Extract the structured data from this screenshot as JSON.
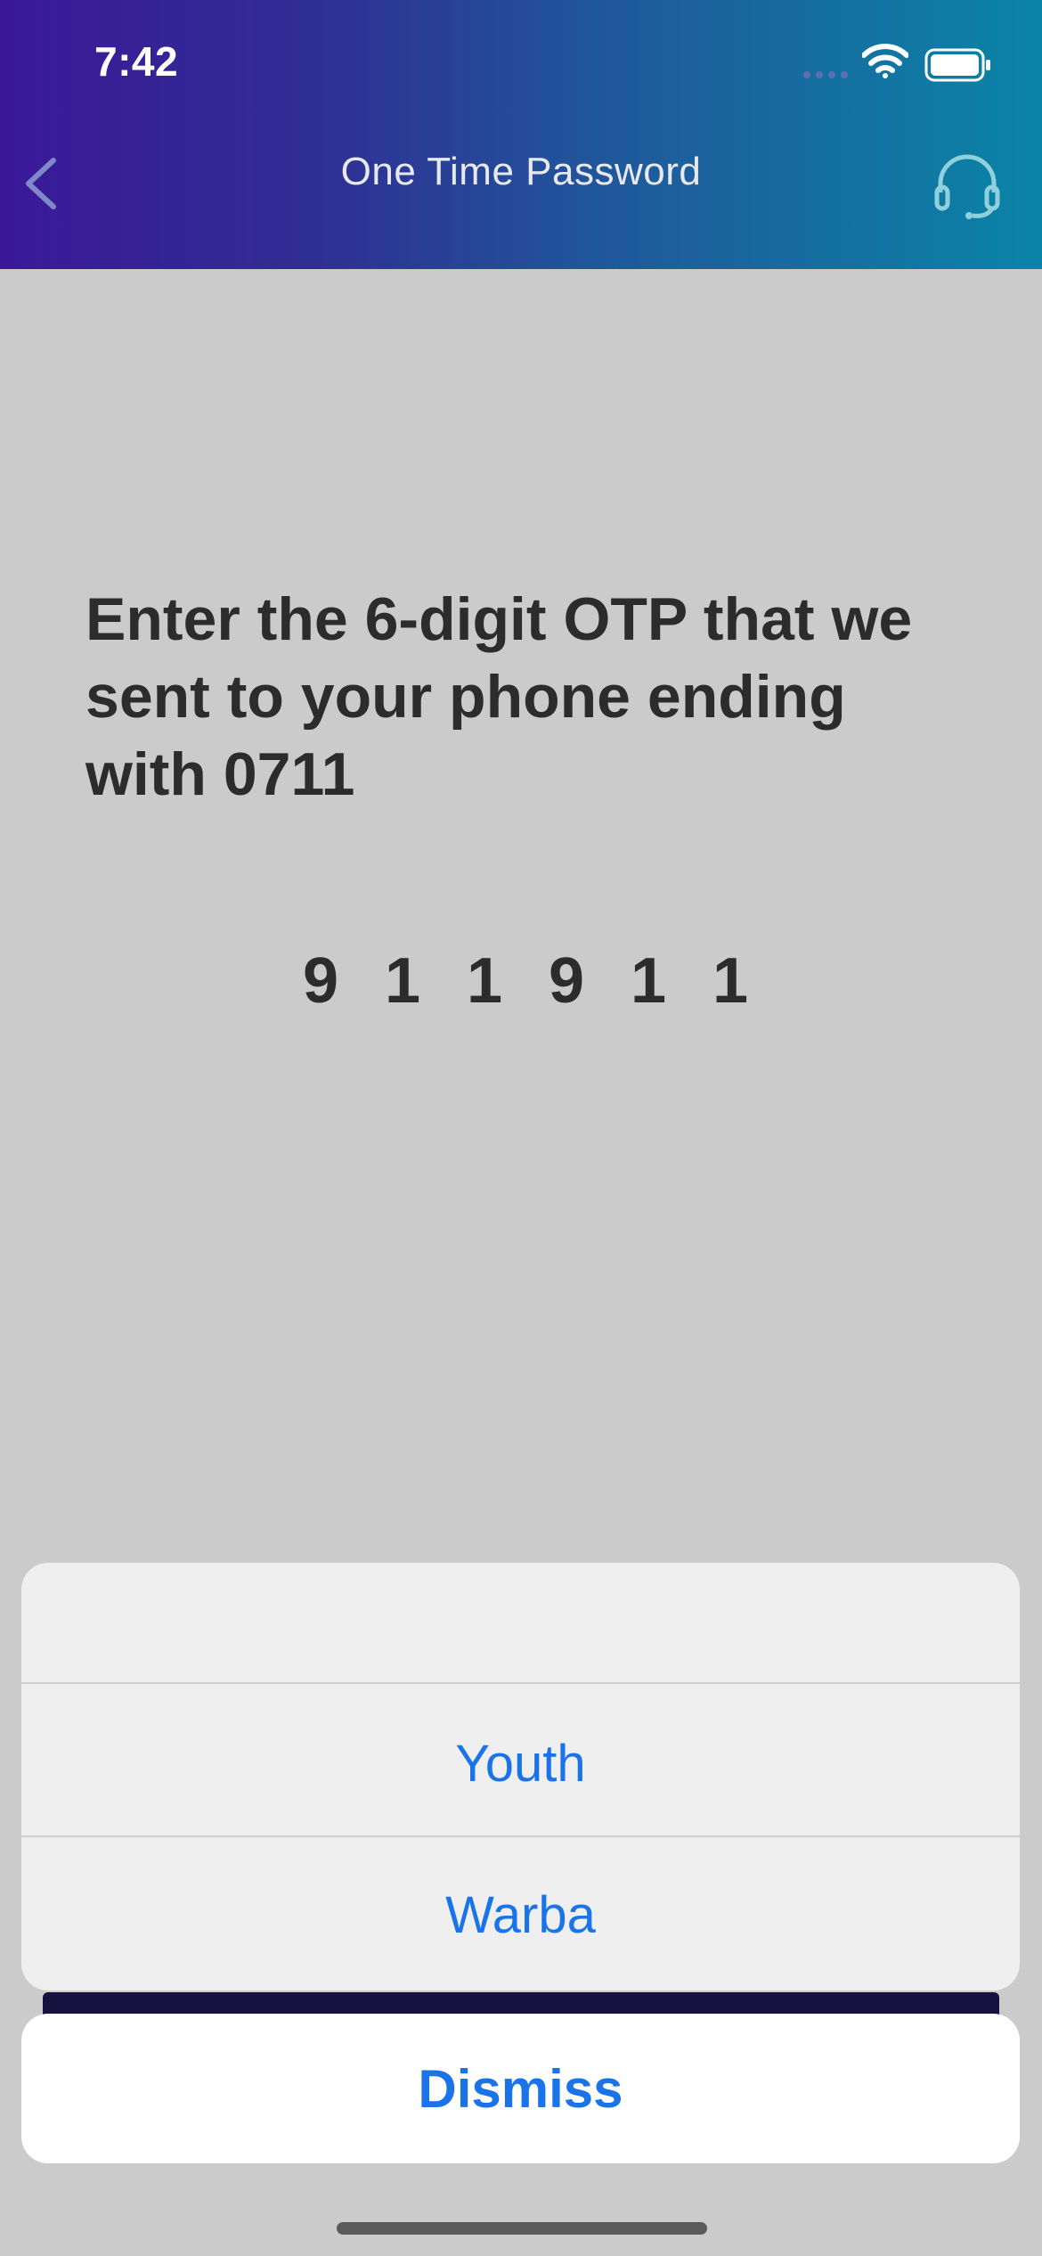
{
  "status_bar": {
    "time": "7:42",
    "icons": [
      "cellular-signal-icon",
      "wifi-icon",
      "battery-icon"
    ]
  },
  "header": {
    "title": "One Time Password",
    "back_icon": "chevron-left-icon",
    "support_icon": "headset-icon",
    "gradient": [
      "#3b1898",
      "#0a84a6"
    ]
  },
  "content": {
    "prompt": "Enter the 6-digit OTP that we sent to your phone ending with 0711",
    "otp_digits": [
      "9",
      "1",
      "1",
      "9",
      "1",
      "1"
    ]
  },
  "action_sheet": {
    "options": [
      "Youth",
      "Warba"
    ],
    "dismiss_label": "Dismiss",
    "accent_color": "#1a73e8"
  }
}
